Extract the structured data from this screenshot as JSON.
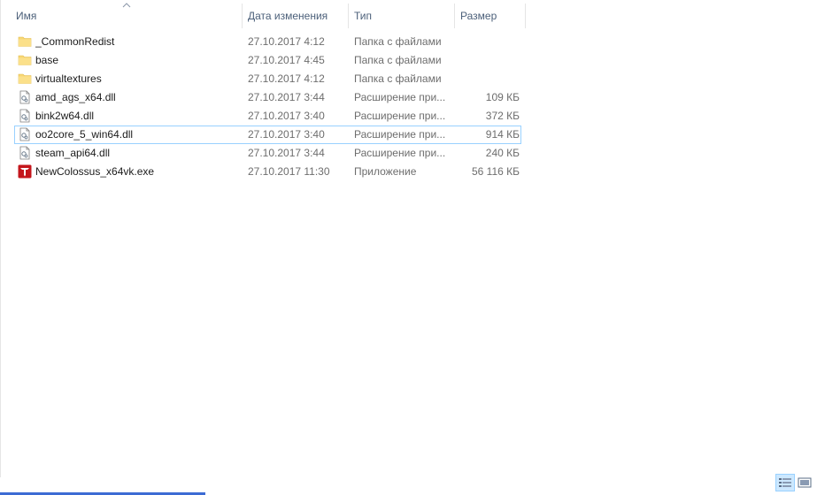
{
  "columns": {
    "name": "Имя",
    "date": "Дата изменения",
    "type": "Тип",
    "size": "Размер"
  },
  "files": [
    {
      "name": "_CommonRedist",
      "date": "27.10.2017 4:12",
      "type": "Папка с файлами",
      "size": "",
      "icon": "folder-icon"
    },
    {
      "name": "base",
      "date": "27.10.2017 4:45",
      "type": "Папка с файлами",
      "size": "",
      "icon": "folder-icon"
    },
    {
      "name": "virtualtextures",
      "date": "27.10.2017 4:12",
      "type": "Папка с файлами",
      "size": "",
      "icon": "folder-icon"
    },
    {
      "name": "amd_ags_x64.dll",
      "date": "27.10.2017 3:44",
      "type": "Расширение при...",
      "size": "109 КБ",
      "icon": "dll-file-icon"
    },
    {
      "name": "bink2w64.dll",
      "date": "27.10.2017 3:40",
      "type": "Расширение при...",
      "size": "372 КБ",
      "icon": "dll-file-icon"
    },
    {
      "name": "oo2core_5_win64.dll",
      "date": "27.10.2017 3:40",
      "type": "Расширение при...",
      "size": "914 КБ",
      "icon": "dll-file-icon",
      "selected": true
    },
    {
      "name": "steam_api64.dll",
      "date": "27.10.2017 3:44",
      "type": "Расширение при...",
      "size": "240 КБ",
      "icon": "dll-file-icon"
    },
    {
      "name": "NewColossus_x64vk.exe",
      "date": "27.10.2017 11:30",
      "type": "Приложение",
      "size": "56 116 КБ",
      "icon": "game-exe-icon"
    }
  ],
  "colors": {
    "header_text": "#4c607a",
    "selection_border": "#99d1ff",
    "selection_fill": "#cce8ff",
    "folder": "#f8d775",
    "exe_red": "#c4161c"
  },
  "view_buttons": [
    {
      "icon": "details-view-icon",
      "active": true
    },
    {
      "icon": "large-icons-view-icon",
      "active": false
    }
  ]
}
